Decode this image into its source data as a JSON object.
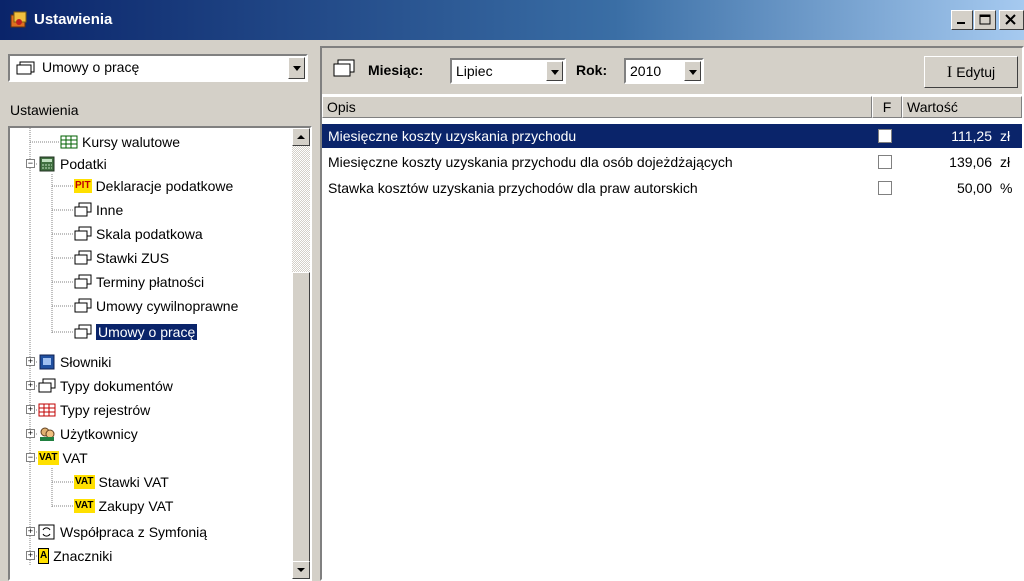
{
  "window": {
    "title": "Ustawienia"
  },
  "left_panel": {
    "combo_value": "Umowy o pracę",
    "header": "Ustawienia",
    "tree": [
      {
        "label": "Kursy walutowe",
        "icon": "table-icon"
      },
      {
        "label": "Podatki",
        "icon": "calculator-icon"
      },
      {
        "label": "Deklaracje podatkowe",
        "icon": "pit-icon",
        "badge": "PIT"
      },
      {
        "label": "Inne",
        "icon": "folder-icon"
      },
      {
        "label": "Skala podatkowa",
        "icon": "folder-icon"
      },
      {
        "label": "Stawki ZUS",
        "icon": "folder-icon"
      },
      {
        "label": "Terminy płatności",
        "icon": "folder-icon"
      },
      {
        "label": "Umowy cywilnoprawne",
        "icon": "folder-icon"
      },
      {
        "label": "Umowy o pracę",
        "icon": "folder-icon"
      },
      {
        "label": "Słowniki",
        "icon": "book-icon"
      },
      {
        "label": "Typy dokumentów",
        "icon": "folder-icon"
      },
      {
        "label": "Typy rejestrów",
        "icon": "register-icon"
      },
      {
        "label": "Użytkownicy",
        "icon": "users-icon"
      },
      {
        "label": "VAT",
        "icon": "vat-icon",
        "badge": "VAT"
      },
      {
        "label": "Stawki VAT",
        "icon": "vat-icon",
        "badge": "VAT"
      },
      {
        "label": "Zakupy VAT",
        "icon": "vat-icon",
        "badge": "VAT"
      },
      {
        "label": "Współpraca z Symfonią",
        "icon": "sync-icon"
      },
      {
        "label": "Znaczniki",
        "icon": "marker-icon",
        "badge": "A"
      }
    ]
  },
  "right_panel": {
    "month_label": "Miesiąc:",
    "month_value": "Lipiec",
    "year_label": "Rok:",
    "year_value": "2010",
    "edit_button": "Edytuj",
    "edit_icon_glyph": "I",
    "columns": {
      "desc": "Opis",
      "flag": "F",
      "value": "Wartość"
    },
    "rows": [
      {
        "desc": "Miesięczne koszty uzyskania przychodu",
        "value": "111,25",
        "unit": "zł"
      },
      {
        "desc": "Miesięczne koszty uzyskania przychodu dla osób dojeżdżających",
        "value": "139,06",
        "unit": "zł"
      },
      {
        "desc": "Stawka kosztów uzyskania przychodów dla praw autorskich",
        "value": "50,00",
        "unit": "%"
      }
    ]
  },
  "colors": {
    "title_start": "#0a246a",
    "selection": "#0a246a",
    "face": "#d4d0c8"
  }
}
